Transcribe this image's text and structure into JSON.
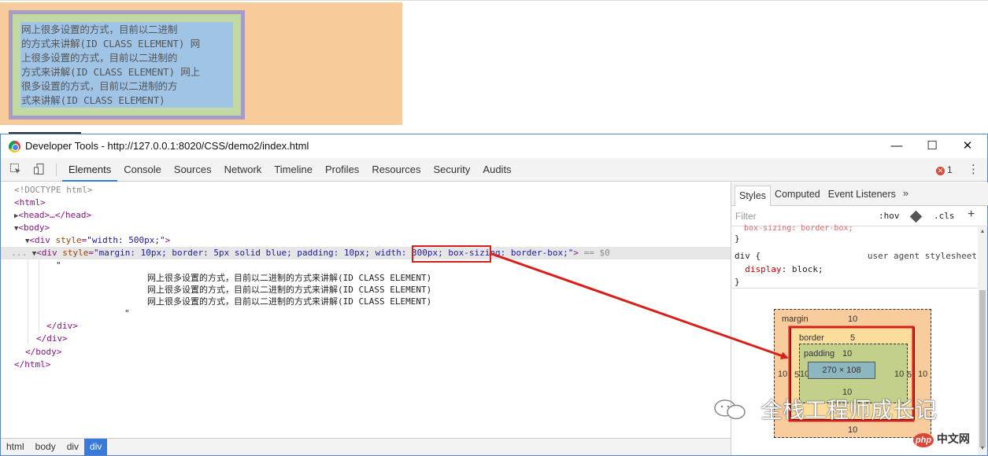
{
  "page": {
    "demo_lines": [
      "网上很多设置的方式，目前以二进制",
      "的方式来讲解(ID CLASS ELEMENT) 网",
      "上很多设置的方式，目前以二进制的",
      "方式来讲解(ID CLASS ELEMENT) 网上",
      "很多设置的方式，目前以二进制的方",
      "式来讲解(ID CLASS ELEMENT)"
    ]
  },
  "window": {
    "title": "Developer Tools - http://127.0.0.1:8020/CSS/demo2/index.html",
    "minimize": "—",
    "maximize": "☐",
    "close": "✕"
  },
  "toolbar": {
    "tabs": [
      "Elements",
      "Console",
      "Sources",
      "Network",
      "Timeline",
      "Profiles",
      "Resources",
      "Security",
      "Audits"
    ],
    "error_count": "1"
  },
  "dom": {
    "doctype": "<!DOCTYPE html>",
    "html_open": "<html>",
    "head": "<head>…</head>",
    "body_open": "<body>",
    "div1_tag": "<div ",
    "div1_attr": "style",
    "div1_val": "\"width: 500px;\"",
    "div1_close": ">",
    "div2_tag": "<div ",
    "div2_attr": "style",
    "div2_val_a": "\"margin: 10px; border: 5px solid blue; padding: 10px; ",
    "div2_val_b": "width: 300px;",
    "div2_val_c": " box-sizing: border-box;\"",
    "div2_close": ">",
    "selected_marker": " == $0",
    "quote_open": "\"",
    "text_lines": [
      "网上很多设置的方式，目前以二进制的方式来讲解(ID CLASS ELEMENT)",
      "网上很多设置的方式，目前以二进制的方式来讲解(ID CLASS ELEMENT)",
      "网上很多设置的方式，目前以二进制的方式来讲解(ID CLASS ELEMENT)"
    ],
    "quote_close": "\"",
    "div_end1": "</div>",
    "div_end2": "</div>",
    "body_end": "</body>",
    "html_end": "</html>"
  },
  "breadcrumbs": [
    "html",
    "body",
    "div",
    "div"
  ],
  "sidebar": {
    "tabs": [
      "Styles",
      "Computed",
      "Event Listeners"
    ],
    "more": "»",
    "filter_placeholder": "Filter",
    "hov": ":hov",
    "cls": ".cls",
    "add": "+",
    "rule_close": "}",
    "ua_selector": "div {",
    "ua_label": "user agent stylesheet",
    "ua_prop": "display",
    "ua_value": "block;",
    "ua_end": "}"
  },
  "box_model": {
    "margin_label": "margin",
    "margin_top": "10",
    "margin_left": "10",
    "margin_right": "10",
    "margin_bottom": "10",
    "border_label": "border",
    "border_top": "5",
    "border_left": "5",
    "border_right": "5",
    "border_bottom": "",
    "padding_label": "padding",
    "padding_top": "10",
    "padding_left": "10",
    "padding_right": "10",
    "padding_bottom": "10",
    "content_size": "270 × 108"
  },
  "watermark": {
    "text": "全栈工程师成长记",
    "php_logo": "php",
    "php_site": "中文网"
  },
  "colors": {
    "accent": "#3879d9",
    "highlight": "#d8201b",
    "margin": "#f9cc9d",
    "border": "#fddd9b",
    "padding": "#c3d08b",
    "content": "#8cb6c0"
  }
}
